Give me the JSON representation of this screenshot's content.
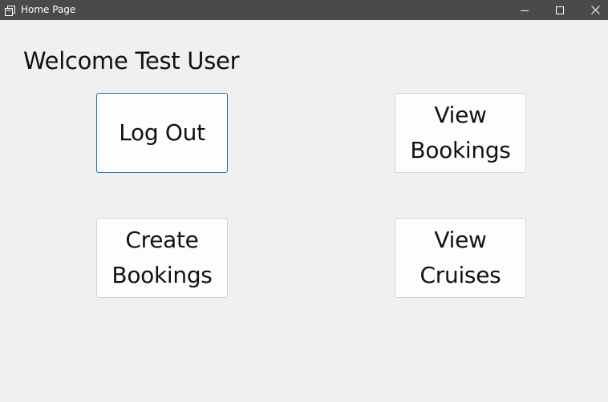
{
  "window": {
    "title": "Home Page",
    "app_icon": "window-restore-icon",
    "controls": {
      "minimize_icon": "minimize-icon",
      "maximize_icon": "maximize-icon",
      "close_icon": "close-icon"
    }
  },
  "main": {
    "welcome_text": "Welcome Test User",
    "buttons": {
      "log_out": "Log Out",
      "view_bookings": "View\nBookings",
      "create_bookings": "Create\nBookings",
      "view_cruises": "View\nCruises"
    }
  },
  "colors": {
    "titlebar": "#4a4a4a",
    "background": "#f0f0f0",
    "button_background": "#fdfdfd",
    "button_border": "#d3d3d3",
    "focus_border": "#1f6fb0"
  }
}
